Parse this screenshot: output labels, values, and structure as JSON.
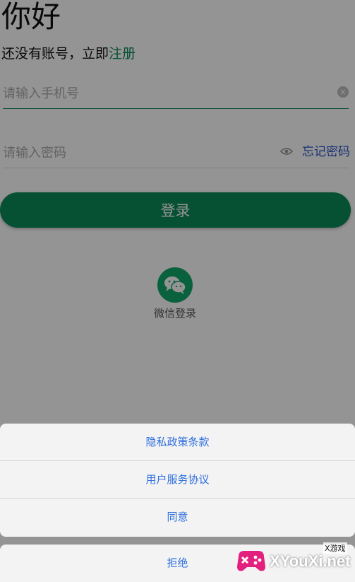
{
  "login": {
    "greeting": "你好",
    "register_prompt": "还没有账号，立即",
    "register_link": "注册",
    "phone_placeholder": "请输入手机号",
    "password_placeholder": "请输入密码",
    "forgot_password": "忘记密码",
    "login_button": "登录",
    "wechat_label": "微信登录"
  },
  "action_sheet": {
    "items": [
      "隐私政策条款",
      "用户服务协议",
      "同意"
    ],
    "cancel": "拒绝"
  },
  "watermark": {
    "text": "XYouXi.net",
    "sub": "X游戏"
  },
  "colors": {
    "accent_green": "#0b8a5a",
    "link_blue": "#2b55c9",
    "sheet_text": "#2f6fde"
  }
}
